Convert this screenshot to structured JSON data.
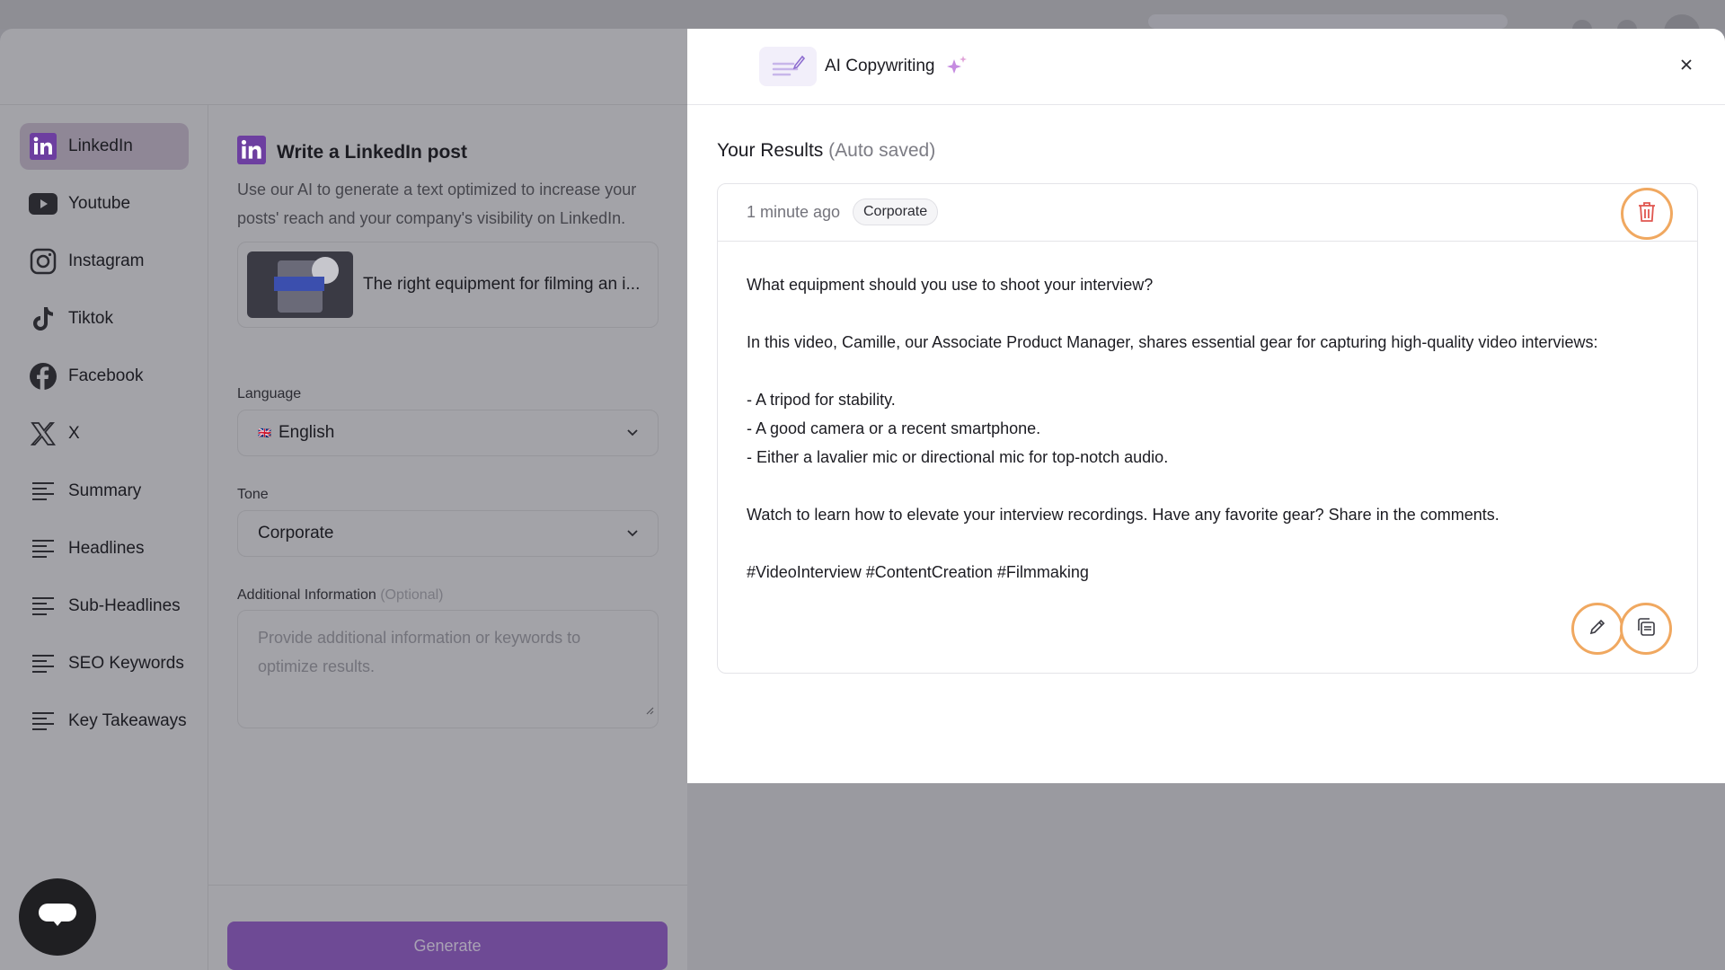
{
  "sidebar": {
    "items": [
      {
        "label": "LinkedIn",
        "icon": "linkedin-icon",
        "active": true
      },
      {
        "label": "Youtube",
        "icon": "youtube-icon"
      },
      {
        "label": "Instagram",
        "icon": "instagram-icon"
      },
      {
        "label": "Tiktok",
        "icon": "tiktok-icon"
      },
      {
        "label": "Facebook",
        "icon": "facebook-icon"
      },
      {
        "label": "X",
        "icon": "x-icon"
      },
      {
        "label": "Summary",
        "icon": "lines-icon"
      },
      {
        "label": "Headlines",
        "icon": "lines-icon"
      },
      {
        "label": "Sub-Headlines",
        "icon": "lines-icon"
      },
      {
        "label": "SEO Keywords",
        "icon": "lines-icon"
      },
      {
        "label": "Key Takeaways",
        "icon": "lines-icon"
      }
    ]
  },
  "form": {
    "title": "Write a LinkedIn post",
    "description": "Use our AI to generate a text optimized to increase your posts' reach and your company's visibility on LinkedIn.",
    "media_title": "The right equipment for filming an i...",
    "language_label": "Language",
    "language_value": "English",
    "language_flag": "🇬🇧",
    "tone_label": "Tone",
    "tone_value": "Corporate",
    "additional_label": "Additional Information",
    "additional_optional": "(Optional)",
    "additional_placeholder": "Provide additional information or keywords to optimize results.",
    "generate_label": "Generate"
  },
  "header": {
    "app_title": "AI Copywriting"
  },
  "results": {
    "title": "Your Results",
    "subtitle": "(Auto saved)",
    "time": "1 minute ago",
    "tag": "Corporate",
    "lines": [
      "What equipment should you use to shoot your interview?",
      "",
      "In this video, Camille, our Associate Product Manager, shares essential gear for capturing high-quality video interviews:",
      "",
      "- A tripod for stability.",
      "- A good camera or a recent smartphone.",
      "- Either a lavalier mic or directional mic for top-notch audio.",
      "",
      "Watch to learn how to elevate your interview recordings. Have any favorite gear? Share in the comments.",
      "",
      "#VideoInterview #ContentCreation #Filmmaking"
    ]
  },
  "colors": {
    "accent": "#6e4a95",
    "highlight_ring": "#f0a860",
    "delete_red": "#e0564f"
  }
}
